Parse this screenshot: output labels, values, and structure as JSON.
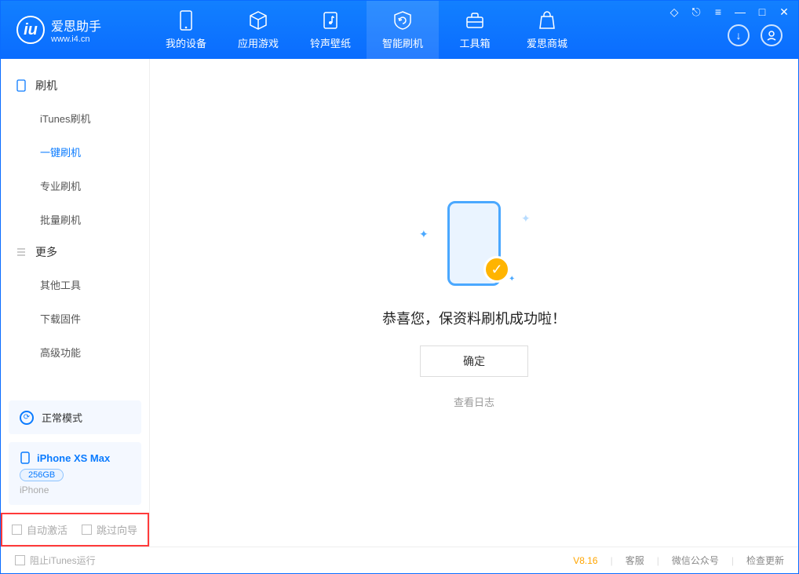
{
  "app": {
    "title": "爱思助手",
    "url": "www.i4.cn"
  },
  "tabs": {
    "device": "我的设备",
    "apps": "应用游戏",
    "ringtone": "铃声壁纸",
    "flash": "智能刷机",
    "toolbox": "工具箱",
    "store": "爱思商城"
  },
  "sidebar": {
    "section_flash": "刷机",
    "items_flash": {
      "itunes": "iTunes刷机",
      "oneclick": "一键刷机",
      "pro": "专业刷机",
      "batch": "批量刷机"
    },
    "section_more": "更多",
    "items_more": {
      "other": "其他工具",
      "firmware": "下载固件",
      "advanced": "高级功能"
    },
    "mode": "正常模式",
    "device": {
      "name": "iPhone XS Max",
      "storage": "256GB",
      "type": "iPhone"
    },
    "auto_activate": "自动激活",
    "skip_guide": "跳过向导"
  },
  "main": {
    "success": "恭喜您，保资料刷机成功啦！",
    "ok": "确定",
    "view_log": "查看日志"
  },
  "status": {
    "block_itunes": "阻止iTunes运行",
    "version": "V8.16",
    "support": "客服",
    "wechat": "微信公众号",
    "update": "检查更新"
  }
}
